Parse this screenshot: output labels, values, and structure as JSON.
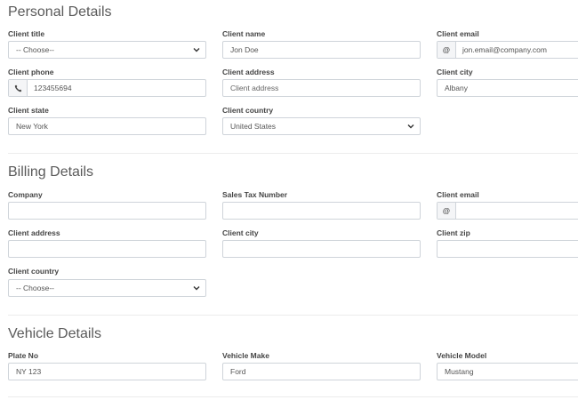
{
  "personal": {
    "title": "Personal Details",
    "client_title": {
      "label": "Client title",
      "value": "-- Choose--"
    },
    "client_name": {
      "label": "Client name",
      "value": "Jon Doe"
    },
    "client_email": {
      "label": "Client email",
      "addon": "@",
      "value": "jon.email@company.com"
    },
    "client_phone": {
      "label": "Client phone",
      "value": "123455694"
    },
    "client_address": {
      "label": "Client address",
      "placeholder": "Client address"
    },
    "client_city": {
      "label": "Client city",
      "value": "Albany"
    },
    "client_state": {
      "label": "Client state",
      "value": "New York"
    },
    "client_country": {
      "label": "Client country",
      "value": "United States"
    }
  },
  "billing": {
    "title": "Billing Details",
    "company": {
      "label": "Company",
      "value": ""
    },
    "sales_tax": {
      "label": "Sales Tax Number",
      "value": ""
    },
    "client_email": {
      "label": "Client email",
      "addon": "@",
      "value": ""
    },
    "client_address": {
      "label": "Client address",
      "value": ""
    },
    "client_city": {
      "label": "Client city",
      "value": ""
    },
    "client_zip": {
      "label": "Client zip",
      "value": ""
    },
    "client_country": {
      "label": "Client country",
      "value": "-- Choose--"
    }
  },
  "vehicle": {
    "title": "Vehicle Details",
    "plate_no": {
      "label": "Plate No",
      "value": "NY 123"
    },
    "make": {
      "label": "Vehicle Make",
      "value": "Ford"
    },
    "model": {
      "label": "Vehicle Model",
      "value": "Mustang"
    }
  }
}
